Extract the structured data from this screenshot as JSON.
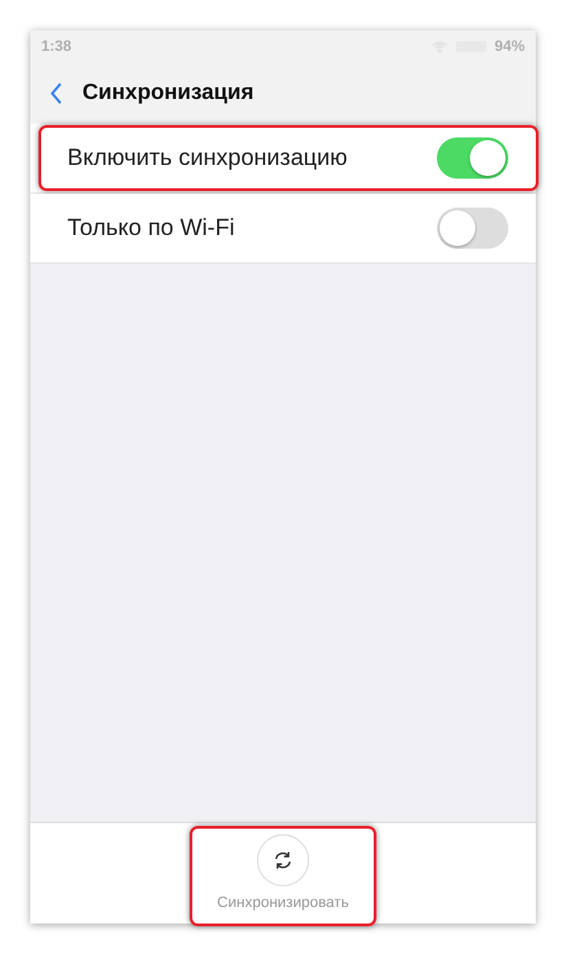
{
  "status_bar": {
    "time": "1:38",
    "battery": "94%"
  },
  "header": {
    "title": "Синхронизация"
  },
  "settings": [
    {
      "label": "Включить синхронизацию",
      "on": true,
      "highlighted": true
    },
    {
      "label": "Только по Wi-Fi",
      "on": false,
      "highlighted": false
    }
  ],
  "bottom_action": {
    "label": "Синхронизировать",
    "highlighted": true
  }
}
